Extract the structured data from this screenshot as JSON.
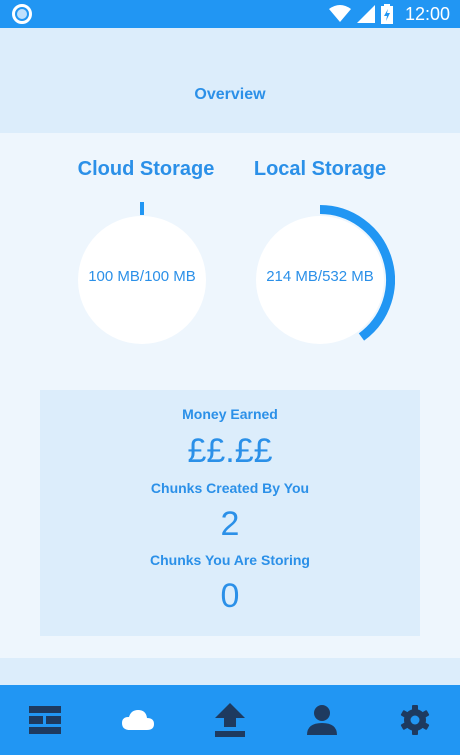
{
  "status_bar": {
    "time": "12:00"
  },
  "header": {
    "title": "Overview"
  },
  "cloud_storage": {
    "title": "Cloud Storage",
    "usage_text": "100 MB/100 MB",
    "fill_fraction": 0.0
  },
  "local_storage": {
    "title": "Local Storage",
    "usage_text": "214 MB/532 MB",
    "fill_fraction": 0.4
  },
  "stats": {
    "money_label": "Money Earned",
    "money_value": "££.££",
    "chunks_created_label": "Chunks Created By You",
    "chunks_created_value": "2",
    "chunks_storing_label": "Chunks You Are Storing",
    "chunks_storing_value": "0"
  },
  "bottom_nav": {
    "items": [
      "dashboard-icon",
      "cloud-icon",
      "upload-icon",
      "account-icon",
      "settings-icon"
    ]
  },
  "colors": {
    "accent": "#2196f3",
    "text": "#2b90e8",
    "panel": "#dcedfb",
    "background": "#eef6fd"
  }
}
